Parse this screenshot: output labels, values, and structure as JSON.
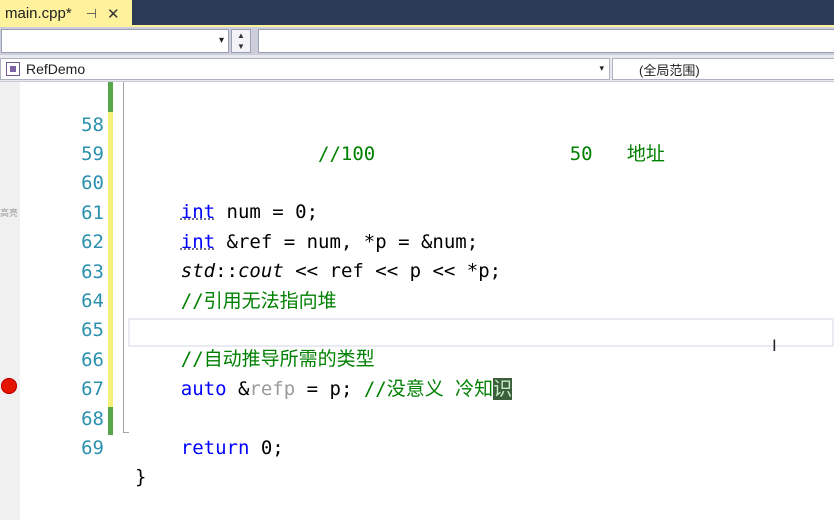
{
  "tab": {
    "title": "main.cpp*",
    "pin": "⊣",
    "close": "✕"
  },
  "toolbar": {
    "combo_arrow": "▾",
    "spin_up": "▲",
    "spin_down": "▼"
  },
  "navbar": {
    "class_name": "RefDemo",
    "scope": "(全局范围)",
    "arrow": "▾"
  },
  "margin_text": "高亮",
  "colors": {
    "tab_active": "#fff29d",
    "keyword": "#0000ff",
    "comment": "#008000",
    "line_number": "#2b91af",
    "breakpoint": "#e51400"
  },
  "lines": [
    {
      "num": "58",
      "pre": "                ",
      "comment": "//100                 50   地址"
    },
    {
      "num": "59"
    },
    {
      "num": "60",
      "pre": "    ",
      "kw": "int",
      "rest": " num = 0;"
    },
    {
      "num": "61",
      "pre": "    ",
      "kw": "int",
      "rest": " &ref = num, *p = &num;"
    },
    {
      "num": "62",
      "pre": "    ",
      "ns": "std",
      "sep": "::",
      "fn": "cout",
      "rest": " << ref << p << *p;"
    },
    {
      "num": "63",
      "pre": "    ",
      "comment": "//引用无法指向堆"
    },
    {
      "num": "64"
    },
    {
      "num": "65",
      "pre": "    ",
      "comment": "//自动推导所需的类型"
    },
    {
      "num": "66",
      "pre": "    ",
      "kw": "auto",
      "rest1": " &",
      "faded": "refp",
      "rest2": " = p; ",
      "comment": "//没意义 冷知",
      "cursor_char": "识"
    },
    {
      "num": "67"
    },
    {
      "num": "68",
      "pre": "    ",
      "kw": "return",
      "rest": " 0;"
    },
    {
      "num": "69",
      "brace": "}"
    }
  ]
}
